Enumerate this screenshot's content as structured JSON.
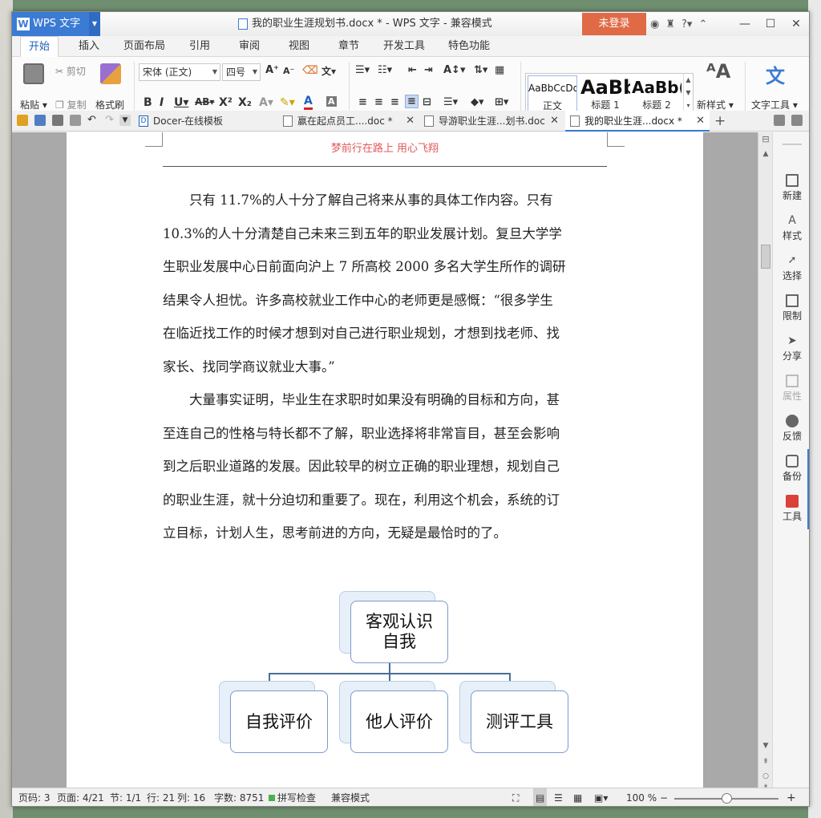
{
  "app": {
    "menu_button": "WPS 文字",
    "window_title": "我的职业生涯规划书.docx * - WPS 文字 - 兼容模式",
    "login": "未登录",
    "title_icons": [
      "?"
    ]
  },
  "menu_tabs": [
    "开始",
    "插入",
    "页面布局",
    "引用",
    "审阅",
    "视图",
    "章节",
    "开发工具",
    "特色功能"
  ],
  "ribbon": {
    "paste": "粘贴",
    "cut": "剪切",
    "copy": "复制",
    "format_painter": "格式刷",
    "font_name": "宋体 (正文)",
    "font_size": "四号",
    "styles": [
      {
        "preview": "AaBbCcDd",
        "name": "正文"
      },
      {
        "preview": "AaBb",
        "name": "标题 1"
      },
      {
        "preview": "AaBb(",
        "name": "标题 2"
      }
    ],
    "new_style": "新样式",
    "text_tools": "文字工具"
  },
  "doc_tabs": [
    {
      "label": "Docer-在线模板",
      "active": false,
      "closable": false
    },
    {
      "label": "赢在起点员工....doc *",
      "active": false,
      "closable": true
    },
    {
      "label": "导游职业生涯...划书.doc",
      "active": false,
      "closable": true
    },
    {
      "label": "我的职业生涯...docx *",
      "active": true,
      "closable": true
    }
  ],
  "document": {
    "header": "梦前行在路上   用心飞翔",
    "paragraph1": [
      "只有 11.7%的人十分了解自己将来从事的具体工作内容。只有",
      "10.3%的人十分清楚自己未来三到五年的职业发展计划。复旦大学学",
      "生职业发展中心日前面向沪上 7 所高校 2000 多名大学生所作的调研",
      "结果令人担忧。许多高校就业工作中心的老师更是感慨：“很多学生",
      "在临近找工作的时候才想到对自己进行职业规划，才想到找老师、找",
      "家长、找同学商议就业大事。”"
    ],
    "paragraph2": [
      "大量事实证明，毕业生在求职时如果没有明确的目标和方向，甚",
      "至连自己的性格与特长都不了解，职业选择将非常盲目，甚至会影响",
      "到之后职业道路的发展。因此较早的树立正确的职业理想，规划自己",
      "的职业生涯，就十分迫切和重要了。现在，利用这个机会，系统的订",
      "立目标，计划人生，思考前进的方向，无疑是最恰时的了。"
    ],
    "diagram": {
      "root": [
        "客观认识",
        "自我"
      ],
      "children": [
        "自我评价",
        "他人评价",
        "测评工具"
      ]
    }
  },
  "sidebar": [
    {
      "label": "新建",
      "icon": "new-doc-icon",
      "enabled": true
    },
    {
      "label": "样式",
      "icon": "style-icon",
      "enabled": true
    },
    {
      "label": "选择",
      "icon": "select-icon",
      "enabled": true
    },
    {
      "label": "限制",
      "icon": "restrict-icon",
      "enabled": true
    },
    {
      "label": "分享",
      "icon": "share-icon",
      "enabled": true
    },
    {
      "label": "属性",
      "icon": "properties-icon",
      "enabled": false
    },
    {
      "label": "反馈",
      "icon": "feedback-icon",
      "enabled": true
    },
    {
      "label": "备份",
      "icon": "backup-icon",
      "enabled": true
    },
    {
      "label": "工具",
      "icon": "toolbox-icon",
      "enabled": true
    }
  ],
  "status": {
    "page_no": "页码: 3",
    "pages": "页面: 4/21",
    "section": "节: 1/1",
    "row": "行: 21",
    "col": "列: 16",
    "words": "字数: 8751",
    "spell": "拼写检查",
    "compat": "兼容模式",
    "zoom": "100 %",
    "zoom_fraction": 0.5
  },
  "colors": {
    "accent": "#3b7bd4",
    "login": "#e06a45",
    "header_text": "#e05a5a"
  }
}
